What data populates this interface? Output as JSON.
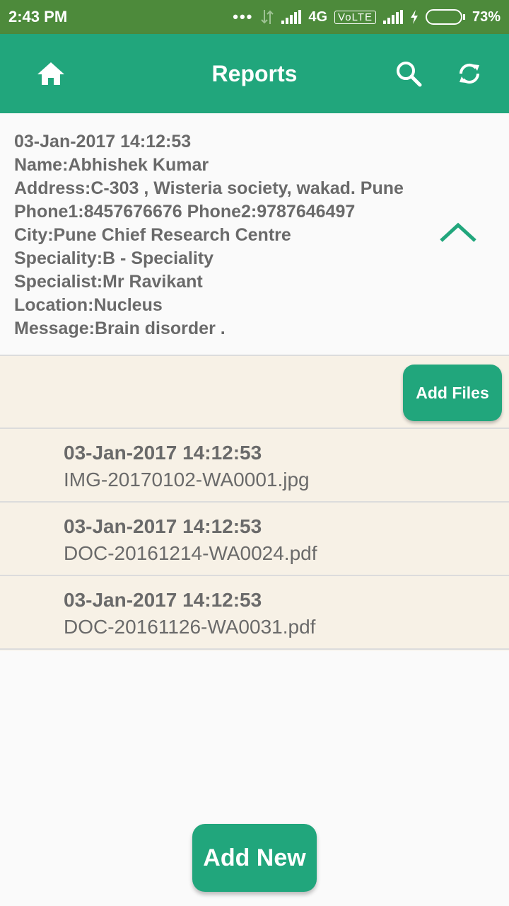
{
  "status_bar": {
    "time": "2:43 PM",
    "network": "4G",
    "volte": "VoLTE",
    "battery": "73%",
    "battery_level": 0.73
  },
  "app_bar": {
    "title": "Reports",
    "icons": [
      "home-icon",
      "search-icon",
      "refresh-icon"
    ],
    "color": "#21a67c"
  },
  "report": {
    "lines": [
      "03-Jan-2017 14:12:53",
      "Name:Abhishek Kumar",
      "Address:C-303 , Wisteria society, wakad. Pune",
      "Phone1:8457676676 Phone2:9787646497",
      "City:Pune Chief Research Centre",
      "Speciality:B - Speciality",
      "Specialist:Mr Ravikant",
      "Location:Nucleus",
      "Message:Brain disorder ."
    ],
    "collapse_icon": "chevron-up-icon"
  },
  "files": {
    "add_label": "Add Files",
    "items": [
      {
        "date": "03-Jan-2017 14:12:53",
        "name": "IMG-20170102-WA0001.jpg"
      },
      {
        "date": "03-Jan-2017 14:12:53",
        "name": "DOC-20161214-WA0024.pdf"
      },
      {
        "date": "03-Jan-2017 14:12:53",
        "name": "DOC-20161126-WA0031.pdf"
      }
    ]
  },
  "add_new_label": "Add New",
  "colors": {
    "status_bar": "#4d8a3b",
    "accent": "#21a67c",
    "files_background": "#f7f1e6",
    "text": "#6a6a6a"
  }
}
